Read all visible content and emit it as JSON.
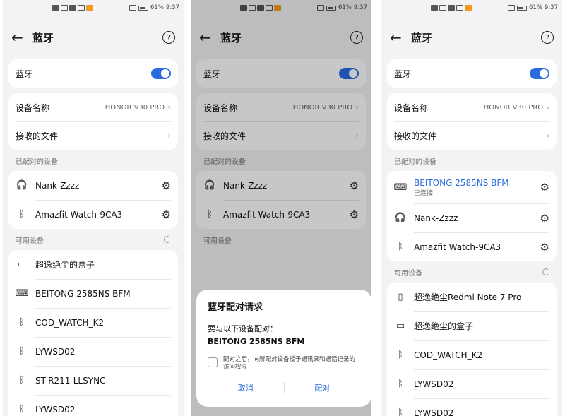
{
  "status": {
    "battery": "61%",
    "time": "9:37"
  },
  "header": {
    "title": "蓝牙",
    "help": "?"
  },
  "bt_toggle_label": "蓝牙",
  "device_name": {
    "label": "设备名称",
    "value": "HONOR V30 PRO"
  },
  "received_files": "接收的文件",
  "paired_section": "已配对的设备",
  "available_section": "可用设备",
  "screen1": {
    "paired": [
      "Nank-Zzzz",
      "Amazfit Watch-9CA3"
    ],
    "available": [
      "超逸绝尘的盒子",
      "BEITONG 2585NS BFM",
      "COD_WATCH_K2",
      "LYWSD02",
      "ST-R211-LLSYNC",
      "LYWSD02"
    ]
  },
  "screen2": {
    "paired": [
      "Nank-Zzzz",
      "Amazfit Watch-9CA3"
    ],
    "dialog": {
      "title": "蓝牙配对请求",
      "text": "要与以下设备配对：",
      "device": "BEITONG 2585NS BFM",
      "checkbox": "配对之后，向所配对设备授予通讯录和通话记录的访问权限",
      "cancel": "取消",
      "confirm": "配对"
    }
  },
  "screen3": {
    "connected": {
      "name": "BEITONG 2585NS BFM",
      "status": "已连接"
    },
    "paired": [
      "Nank-Zzzz",
      "Amazfit Watch-9CA3"
    ],
    "available": [
      "超逸绝尘Redmi Note 7 Pro",
      "超逸绝尘的盒子",
      "COD_WATCH_K2",
      "LYWSD02",
      "LYWSD02"
    ]
  }
}
